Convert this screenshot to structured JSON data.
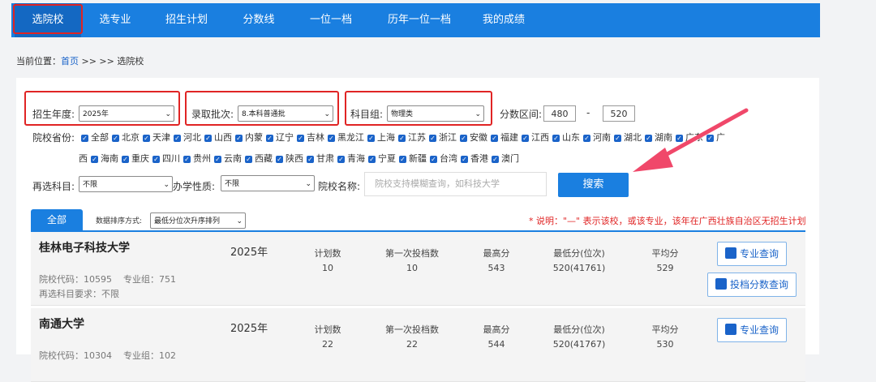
{
  "nav": {
    "items": [
      "选院校",
      "选专业",
      "招生计划",
      "分数线",
      "一位一档",
      "历年一位一档",
      "我的成绩"
    ]
  },
  "crumb": {
    "prefix": "当前位置：",
    "home": "首页",
    "sep": ">> >> ",
    "current": "选院校"
  },
  "filters": {
    "year_label": "招生年度:",
    "year_value": "2025年",
    "batch_label": "录取批次:",
    "batch_value": "8.本科普通批",
    "group_label": "科目组:",
    "group_value": "物理类",
    "range_label": "分数区间:",
    "range_min": "480",
    "range_dash": "-",
    "range_max": "520",
    "province_label": "院校省份:",
    "provinces_row1": [
      "全部",
      "北京",
      "天津",
      "河北",
      "山西",
      "内蒙",
      "辽宁",
      "吉林",
      "黑龙江",
      "上海",
      "江苏",
      "浙江",
      "安徽",
      "福建",
      "江西",
      "山东",
      "河南",
      "湖北",
      "湖南",
      "广东",
      "广"
    ],
    "provinces_row2": [
      "西",
      "海南",
      "重庆",
      "四川",
      "贵州",
      "云南",
      "西藏",
      "陕西",
      "甘肃",
      "青海",
      "宁夏",
      "新疆",
      "台湾",
      "香港",
      "澳门"
    ],
    "subject_label": "再选科目:",
    "subject_value": "不限",
    "nature_label": "办学性质:",
    "nature_value": "不限",
    "name_label": "院校名称:",
    "name_placeholder": "院校支持模糊查询，如科技大学",
    "search_label": "搜索"
  },
  "tabs": {
    "all": "全部",
    "sort_label": "数据排序方式:",
    "sort_value": "最低分位次升序排列"
  },
  "note": "* 说明：\"—\" 表示该校，或该专业，该年在广西壮族自治区无招生计划",
  "schools": [
    {
      "name": "桂林电子科技大学",
      "code": "院校代码：10595",
      "groups": "专业组：751",
      "req": "再选科目要求：不限",
      "year": "2025年",
      "stats": [
        {
          "label": "计划数",
          "value": "10"
        },
        {
          "label": "第一次投档数",
          "value": "10"
        },
        {
          "label": "最高分",
          "value": "543"
        },
        {
          "label": "最低分(位次)",
          "value": "520(41761)"
        },
        {
          "label": "平均分",
          "value": "529"
        }
      ],
      "btn_major": "专业查询",
      "btn_score": "投档分数查询"
    },
    {
      "name": "南通大学",
      "code": "院校代码：10304",
      "groups": "专业组：102",
      "year": "2025年",
      "stats": [
        {
          "label": "计划数",
          "value": "22"
        },
        {
          "label": "第一次投档数",
          "value": "22"
        },
        {
          "label": "最高分",
          "value": "544"
        },
        {
          "label": "最低分(位次)",
          "value": "520(41767)"
        },
        {
          "label": "平均分",
          "value": "530"
        }
      ],
      "btn_major": "专业查询"
    }
  ],
  "colors": {
    "primary": "#1a7fe0",
    "highlight": "#e02424",
    "arrow": "#f0486a"
  }
}
